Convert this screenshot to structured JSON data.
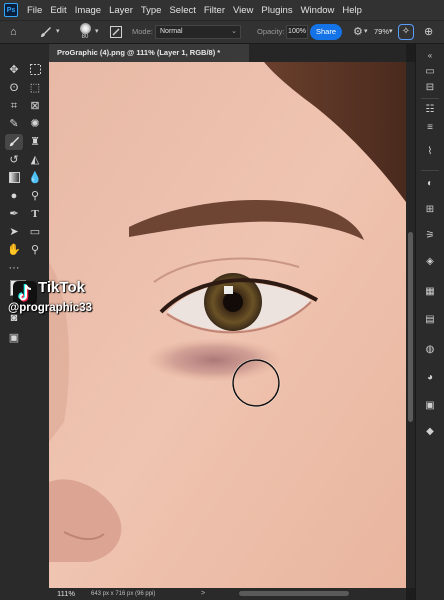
{
  "menu": {
    "logo": "Ps",
    "items": [
      "File",
      "Edit",
      "Image",
      "Layer",
      "Type",
      "Select",
      "Filter",
      "View",
      "Plugins",
      "Window",
      "Help"
    ]
  },
  "options": {
    "brush_size": "80",
    "mode_label": "Mode:",
    "mode_value": "Normal",
    "opacity_label": "Opacity:",
    "opacity_value": "100%",
    "share_label": "Share",
    "zoom_value": "79%",
    "colors": {
      "accent": "#1473e6",
      "highlight_border": "#5a9fff"
    }
  },
  "document": {
    "tab_title": "ProGraphic (4).png @ 111% (Layer 1, RGB/8) *"
  },
  "status": {
    "zoom": "111%",
    "info": "643 px x 716 px (96 ppi)",
    "chevron": ">"
  },
  "watermark": {
    "brand": "TikTok",
    "handle": "@prographic33"
  },
  "toolbar_icons": [
    "move-icon",
    "marquee-icon",
    "lasso-icon",
    "object-select-icon",
    "crop-icon",
    "frame-icon",
    "eyedropper-icon",
    "healing-brush-icon",
    "brush-icon",
    "stamp-icon",
    "history-brush-icon",
    "eraser-icon",
    "gradient-icon",
    "blur-icon",
    "dodge-icon",
    "pen-icon",
    "type-icon",
    "path-select-icon",
    "rectangle-icon",
    "hand-icon",
    "zoom-icon",
    "more-tools-icon",
    "color-swatches",
    "quick-mask-icon",
    "screen-mode-icon"
  ],
  "panel_icons": [
    "panel-collapse-icon",
    "history-icon",
    "adjust-icon",
    "properties-icon",
    "brush-settings-icon",
    "color-icon",
    "swatches-icon",
    "gradients-icon",
    "patterns-icon",
    "libraries-icon",
    "paths-icon",
    "styles-icon",
    "channels-icon",
    "layers-icon"
  ]
}
